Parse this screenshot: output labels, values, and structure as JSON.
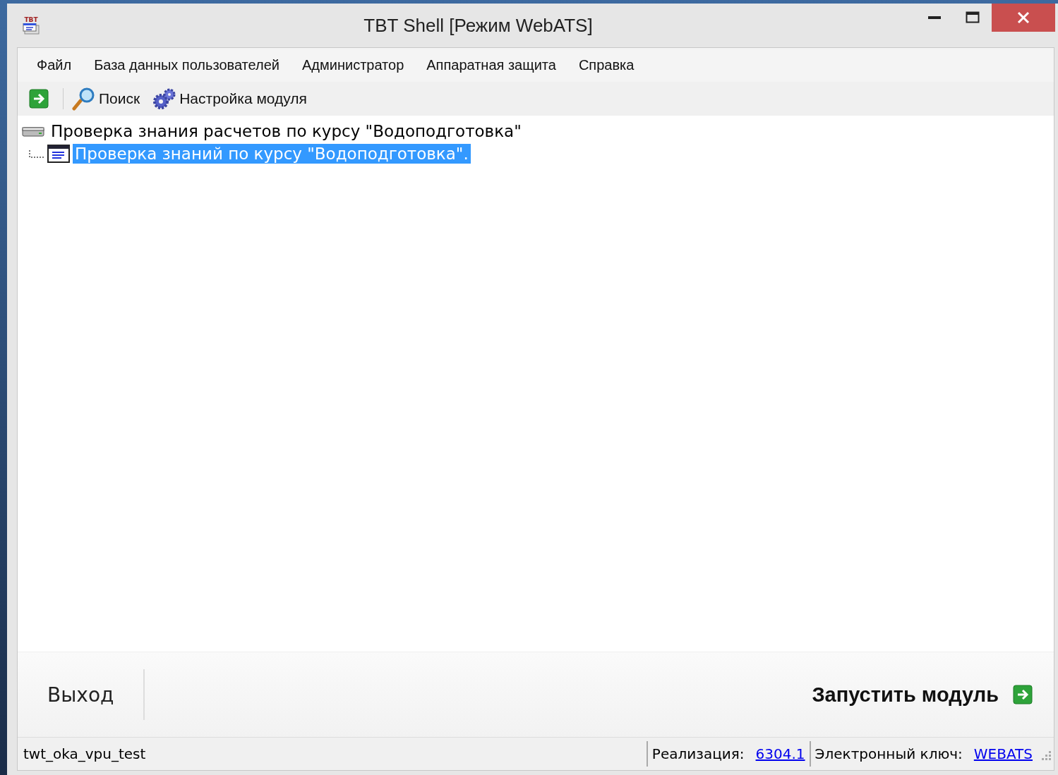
{
  "window": {
    "title": "TBT Shell [Режим WebATS]",
    "icon_text": "TBT"
  },
  "menu": [
    "Файл",
    "База данных пользователей",
    "Администратор",
    "Аппаратная защита",
    "Справка"
  ],
  "toolbar": [
    {
      "kind": "run"
    },
    {
      "kind": "search",
      "label": "Поиск"
    },
    {
      "kind": "settings",
      "label": "Настройка модуля"
    }
  ],
  "tree": [
    {
      "label": "Проверка знания расчетов по курсу \"Водоподготовка\"",
      "selected": false,
      "expanded": true,
      "children": [
        {
          "label": "Проверка знаний по курсу \"Водоподготовка\".",
          "selected": true
        }
      ]
    }
  ],
  "buttons": {
    "exit": "Выход",
    "run": "Запустить модуль"
  },
  "status_bar": {
    "user": "twt_oka_vpu_test",
    "release_label": "Реализация:",
    "release": "6304.1",
    "key_label": "Электронный ключ:",
    "key": "WEBATS"
  }
}
